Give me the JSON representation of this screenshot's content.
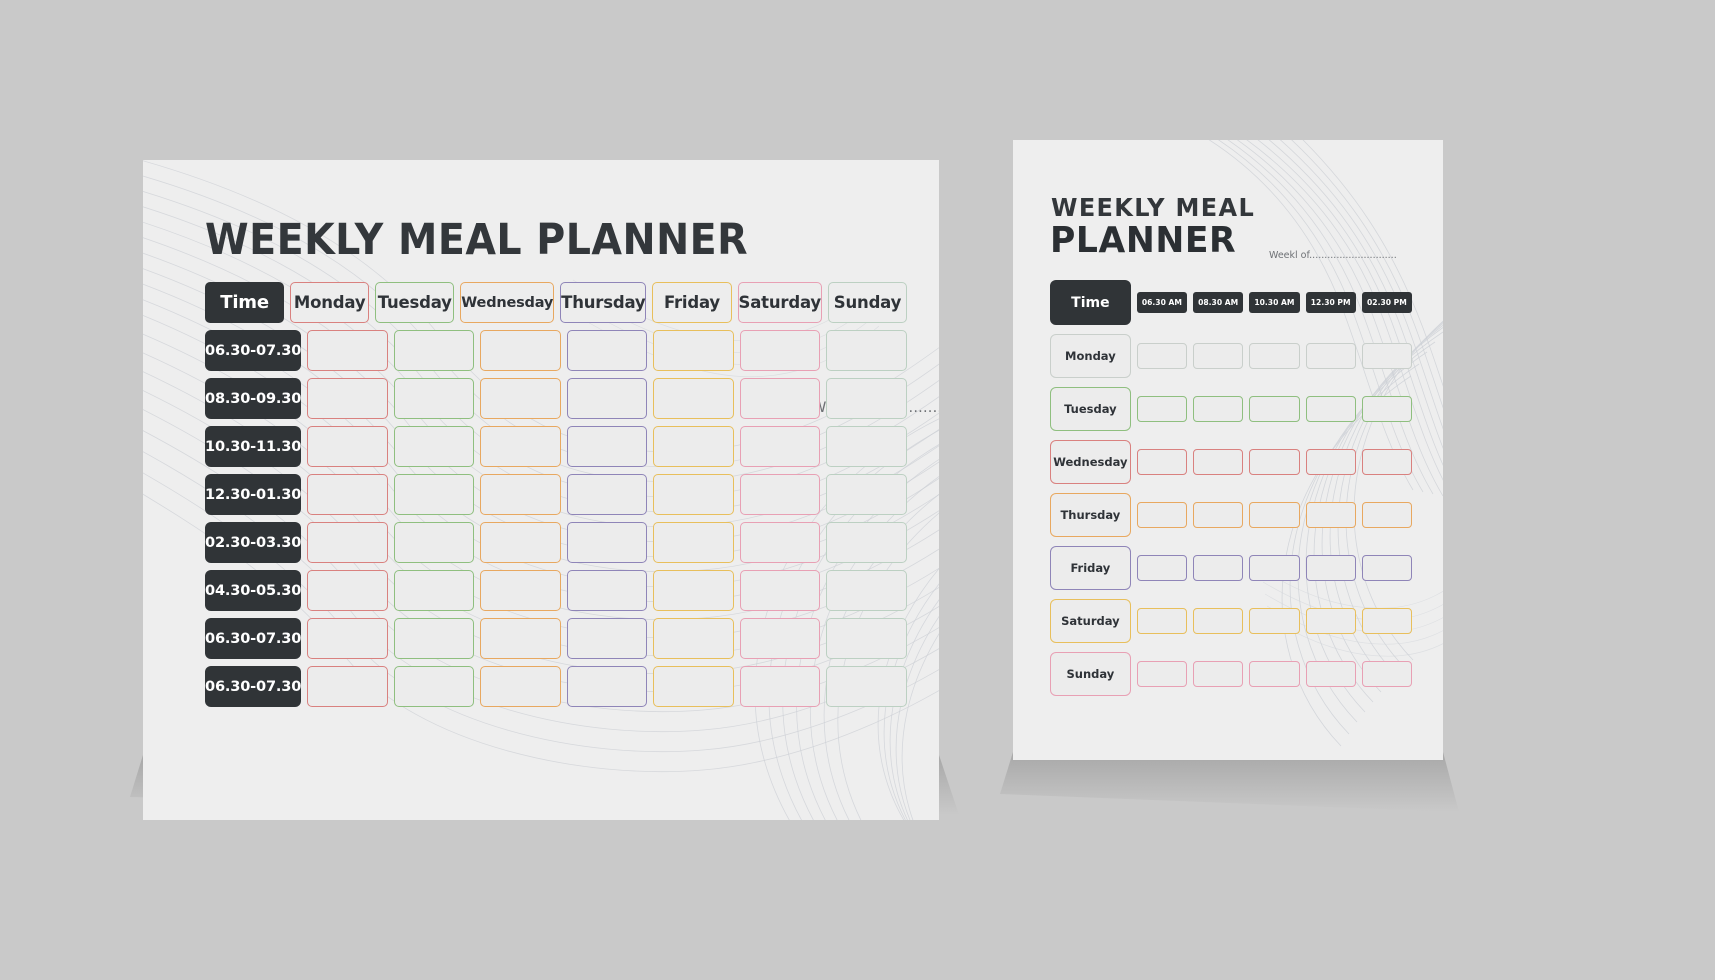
{
  "canvas": {
    "background": "#c9c9c9"
  },
  "colors": {
    "dark": "#303437",
    "paper": "#eeeeee",
    "monday": "#d9817f",
    "tuesday": "#8fbf7f",
    "wednesday": "#e8a860",
    "thursday": "#8f85b8",
    "friday": "#e8bf5c",
    "saturday": "#e8a0b4",
    "sunday": "#a8c4b0",
    "neutral": "#c8c8c8"
  },
  "left_planner": {
    "title": "WEEKLY MEAL PLANNER",
    "week_of_label": "Weekl of...................................",
    "columns": [
      {
        "key": "time",
        "label": "Time",
        "accent": "#303437"
      },
      {
        "key": "monday",
        "label": "Monday",
        "accent": "#d9817f"
      },
      {
        "key": "tuesday",
        "label": "Tuesday",
        "accent": "#8fbf7f"
      },
      {
        "key": "wednesday",
        "label": "Wednesday",
        "accent": "#e8a860"
      },
      {
        "key": "thursday",
        "label": "Thursday",
        "accent": "#8f85b8"
      },
      {
        "key": "friday",
        "label": "Friday",
        "accent": "#e8bf5c"
      },
      {
        "key": "saturday",
        "label": "Saturday",
        "accent": "#e8a0b4"
      },
      {
        "key": "sunday",
        "label": "Sunday",
        "accent": "#bcd0c2"
      }
    ],
    "time_slots": [
      "06.30-07.30",
      "08.30-09.30",
      "10.30-11.30",
      "12.30-01.30",
      "02.30-03.30",
      "04.30-05.30",
      "06.30-07.30",
      "06.30-07.30"
    ],
    "cell_values": [
      [
        "",
        "",
        "",
        "",
        "",
        "",
        ""
      ],
      [
        "",
        "",
        "",
        "",
        "",
        "",
        ""
      ],
      [
        "",
        "",
        "",
        "",
        "",
        "",
        ""
      ],
      [
        "",
        "",
        "",
        "",
        "",
        "",
        ""
      ],
      [
        "",
        "",
        "",
        "",
        "",
        "",
        ""
      ],
      [
        "",
        "",
        "",
        "",
        "",
        "",
        ""
      ],
      [
        "",
        "",
        "",
        "",
        "",
        "",
        ""
      ],
      [
        "",
        "",
        "",
        "",
        "",
        "",
        ""
      ]
    ]
  },
  "right_planner": {
    "title_line1": "WEEKLY MEAL",
    "title_line2": "PLANNER",
    "week_of_label": "Weekl of.............................",
    "time_header_label": "Time",
    "time_slots": [
      "06.30 AM",
      "08.30 AM",
      "10.30 AM",
      "12.30 PM",
      "02.30 PM"
    ],
    "days": [
      {
        "label": "Monday",
        "accent": "#c9cfcb"
      },
      {
        "label": "Tuesday",
        "accent": "#8fbf7f"
      },
      {
        "label": "Wednesday",
        "accent": "#d9817f"
      },
      {
        "label": "Thursday",
        "accent": "#e8a860"
      },
      {
        "label": "Friday",
        "accent": "#8f85b8"
      },
      {
        "label": "Saturday",
        "accent": "#e8bf5c"
      },
      {
        "label": "Sunday",
        "accent": "#e8a0b4"
      }
    ]
  }
}
